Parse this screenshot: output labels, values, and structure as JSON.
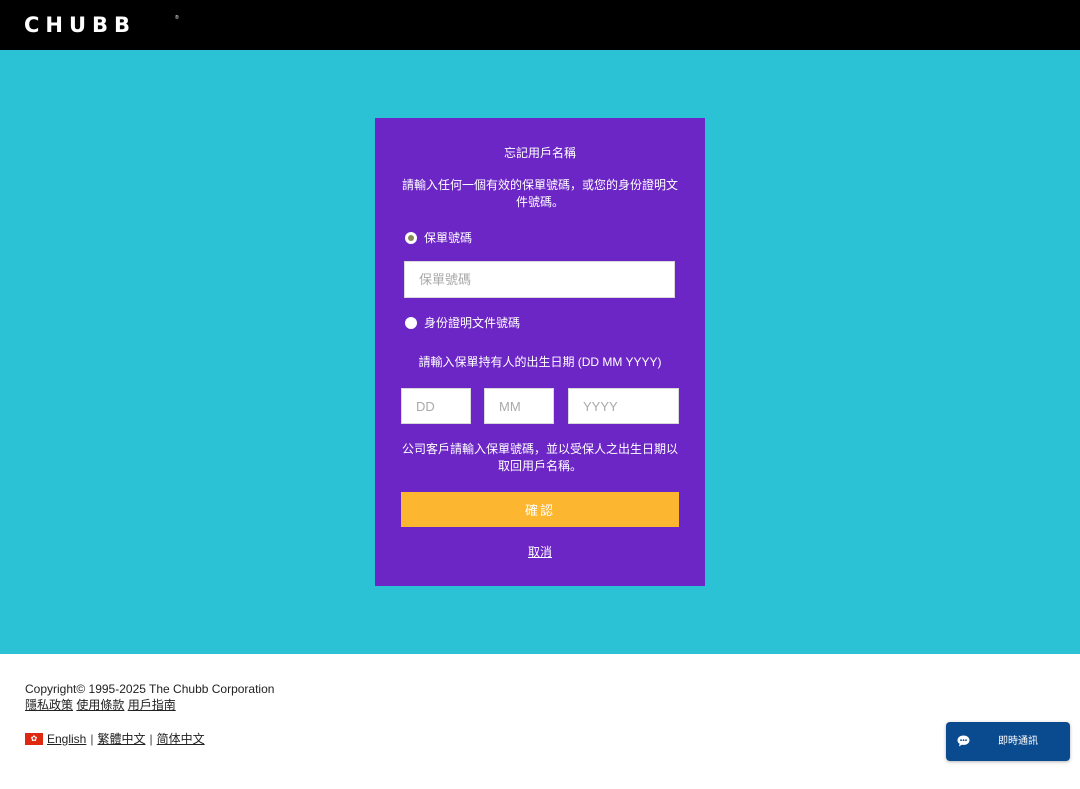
{
  "header": {
    "logo_text": "CHUBB",
    "logo_mark": "®"
  },
  "form": {
    "title": "忘記用戶名稱",
    "instructions": "請輸入任何一個有效的保單號碼，或您的身份證明文件號碼。",
    "option_policy_label": "保單號碼",
    "option_policy_checked": true,
    "policy_input_placeholder": "保單號碼",
    "policy_input_value": "",
    "option_id_label": "身份證明文件號碼",
    "option_id_checked": false,
    "dob_label": "請輸入保單持有人的出生日期 (DD MM YYYY)",
    "dob_day_placeholder": "DD",
    "dob_month_placeholder": "MM",
    "dob_year_placeholder": "YYYY",
    "corporate_note": "公司客戶請輸入保單號碼，並以受保人之出生日期以取回用戶名稱。",
    "confirm_label": "確認",
    "cancel_label": "取消"
  },
  "footer": {
    "copyright": "Copyright© 1995-2025 The Chubb Corporation",
    "links": [
      "隱私政策",
      "使用條款",
      "用戶指南"
    ],
    "languages": [
      "English",
      "繁體中文",
      "简体中文"
    ],
    "language_separator": "|"
  },
  "chat": {
    "label": "即時通訊",
    "icon": "chat-bubble-icon"
  },
  "colors": {
    "header_bg": "#000000",
    "hero_bg": "#2bc2d6",
    "card_bg": "#6c26c6",
    "confirm_bg": "#fdb62f",
    "chat_bg": "#0a4a8f"
  }
}
